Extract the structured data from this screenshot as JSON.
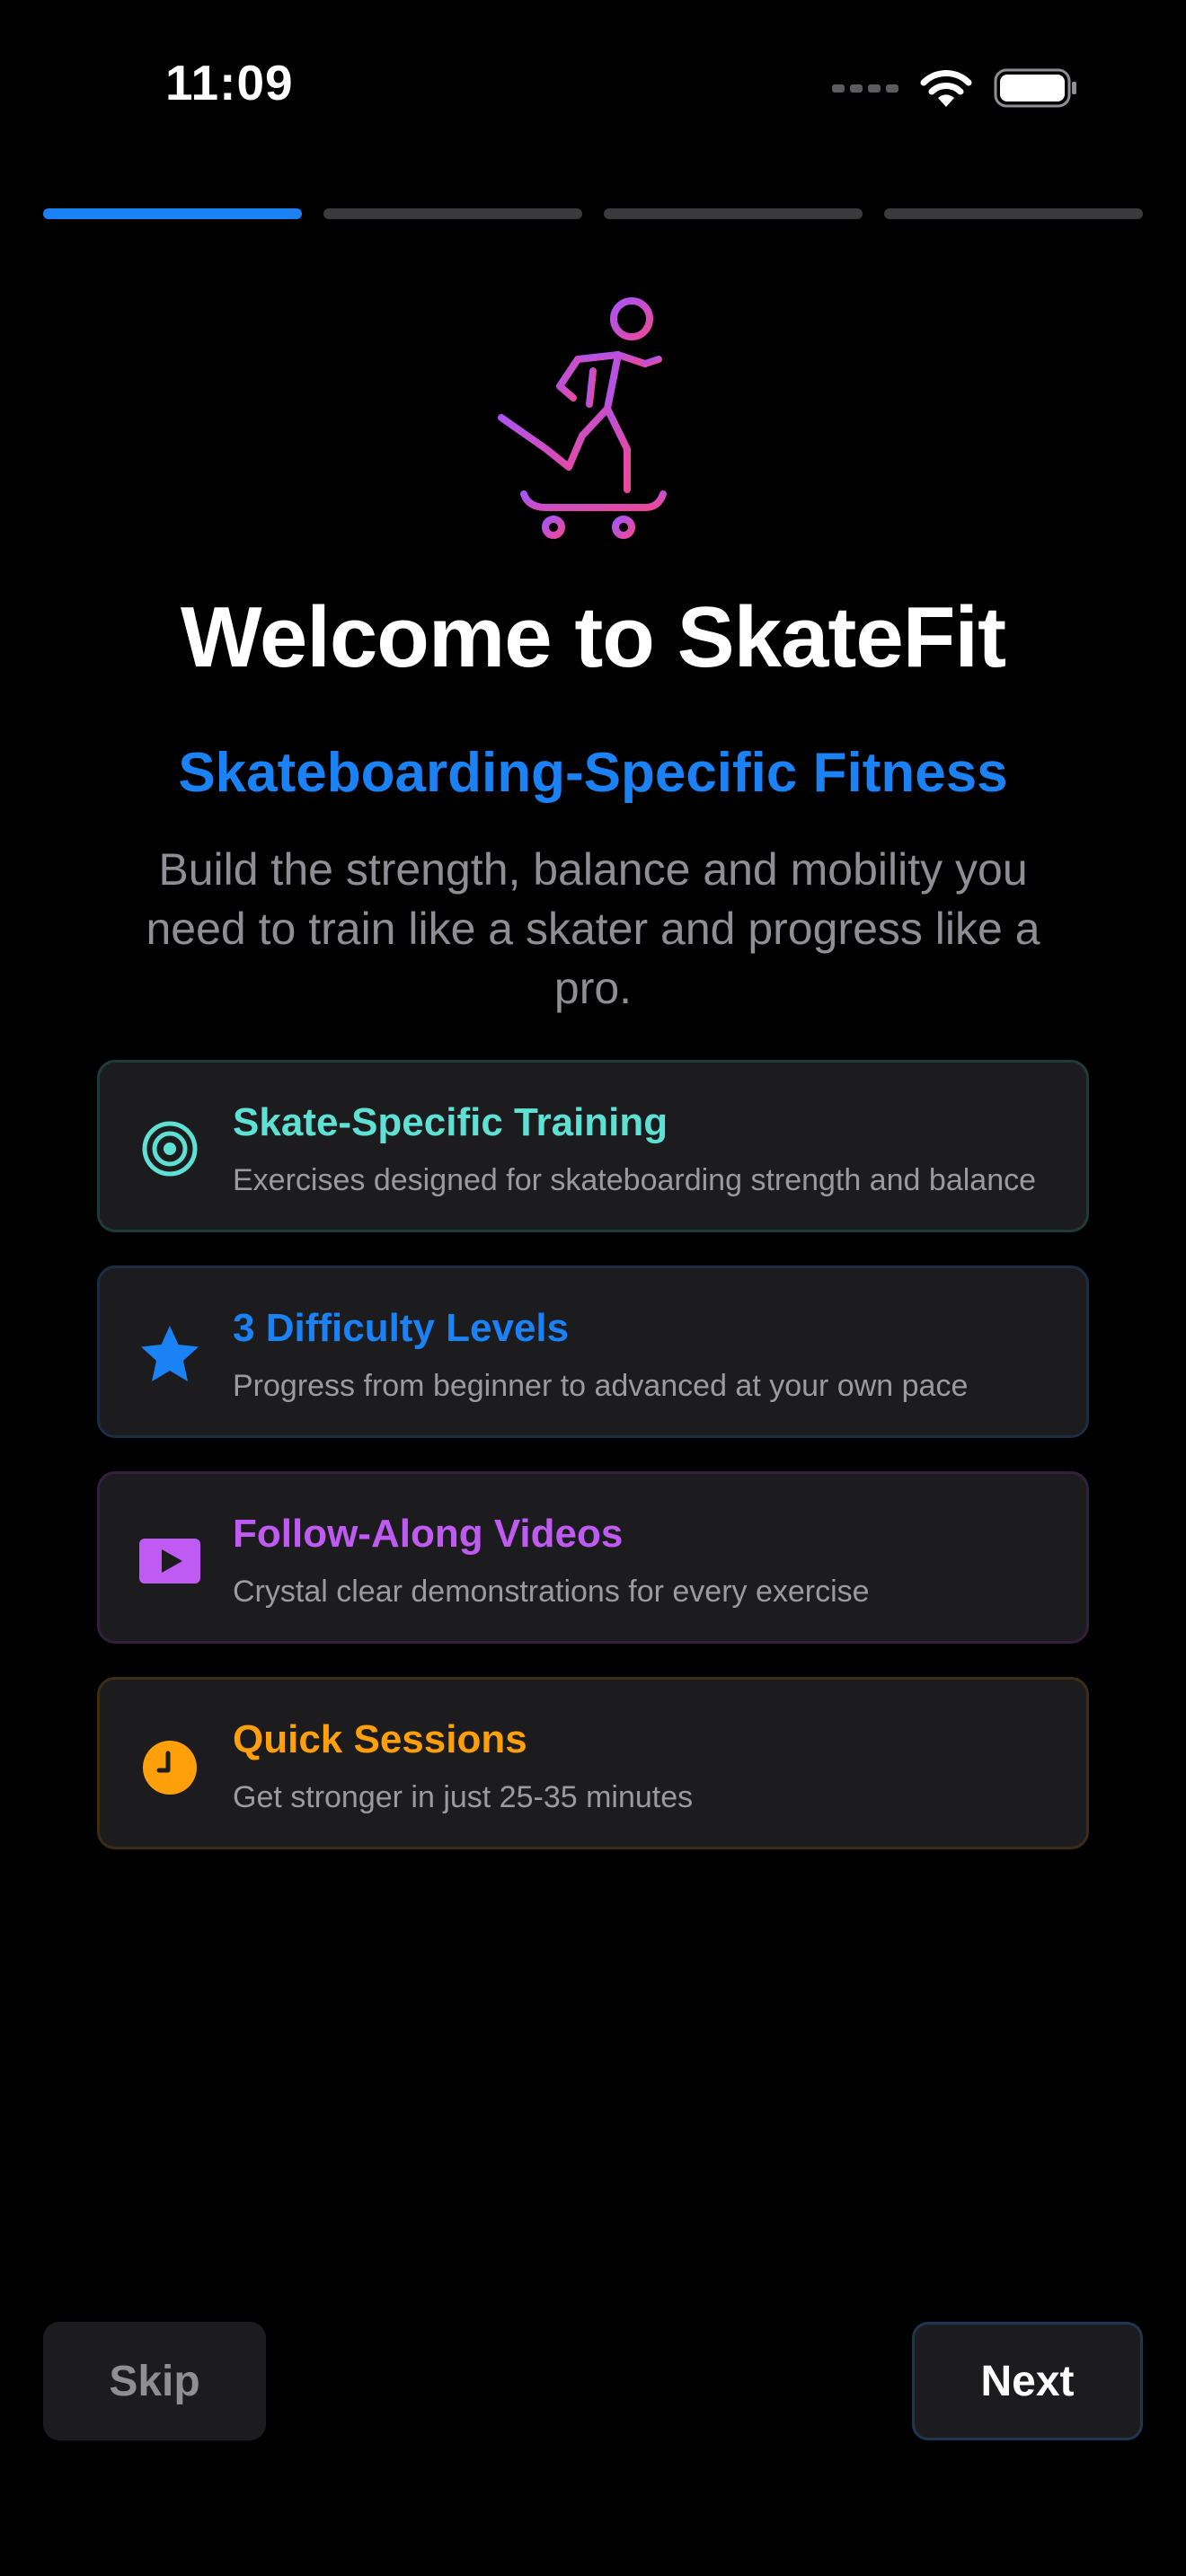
{
  "status_bar": {
    "time": "11:09"
  },
  "progress": {
    "total_steps": 4,
    "current_step": 1
  },
  "hero": {
    "icon": "skater-with-dumbbell-icon"
  },
  "welcome": {
    "title": "Welcome to SkateFit",
    "subtitle": "Skateboarding-Specific Fitness",
    "description": "Build the strength, balance and mobility you need to train like a skater and progress like a pro."
  },
  "features": [
    {
      "title": "Skate-Specific Training",
      "description": "Exercises designed for skateboarding strength and balance",
      "icon": "target-icon",
      "color": "#5ee1d4"
    },
    {
      "title": "3 Difficulty Levels",
      "description": "Progress from beginner to advanced at your own pace",
      "icon": "star-icon",
      "color": "#1a82f5"
    },
    {
      "title": "Follow-Along Videos",
      "description": "Crystal clear demonstrations for every exercise",
      "icon": "play-video-icon",
      "color": "#bf5af2"
    },
    {
      "title": "Quick Sessions",
      "description": "Get stronger in just 25-35 minutes",
      "icon": "clock-icon",
      "color": "#ff9f0a"
    }
  ],
  "buttons": {
    "skip": "Skip",
    "next": "Next"
  },
  "colors": {
    "accent": "#1a82f5",
    "background": "#000000",
    "card_background": "#1c1c1e",
    "hero_gradient_start": "#a855f7",
    "hero_gradient_end": "#ec4899"
  }
}
